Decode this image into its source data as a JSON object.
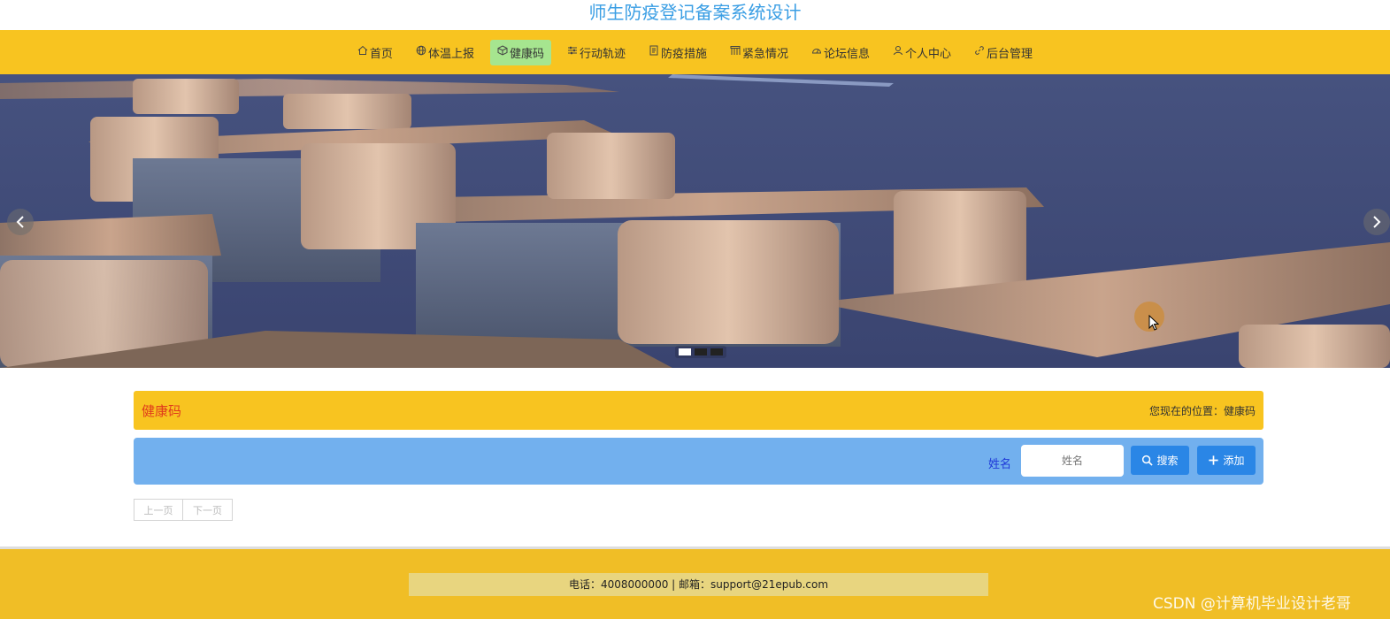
{
  "site": {
    "title": "师生防疫登记备案系统设计"
  },
  "nav": {
    "items": [
      {
        "label": "首页",
        "icon": "home-icon"
      },
      {
        "label": "体温上报",
        "icon": "globe-icon"
      },
      {
        "label": "健康码",
        "icon": "cube-icon",
        "active": true
      },
      {
        "label": "行动轨迹",
        "icon": "sliders-icon"
      },
      {
        "label": "防疫措施",
        "icon": "document-icon"
      },
      {
        "label": "紧急情况",
        "icon": "grid-icon"
      },
      {
        "label": "论坛信息",
        "icon": "dashboard-icon"
      },
      {
        "label": "个人中心",
        "icon": "user-icon"
      },
      {
        "label": "后台管理",
        "icon": "link-icon"
      }
    ]
  },
  "banner": {
    "slides": 3,
    "active_slide": 1
  },
  "crumb": {
    "title": "健康码",
    "location": "您现在的位置：健康码"
  },
  "search": {
    "label": "姓名",
    "placeholder": "姓名",
    "search_button": "搜索",
    "add_button": "添加"
  },
  "pager": {
    "prev": "上一页",
    "next": "下一页"
  },
  "footer": {
    "contact": "电话：4008000000 | 邮箱：support@21epub.com"
  },
  "watermark": "CSDN @计算机毕业设计老哥",
  "colors": {
    "title": "#3a9ee4",
    "nav_bg": "#f8c420",
    "nav_active": "#a6e58f",
    "crumb_title": "#e03c1c",
    "search_bar": "#72b0ee",
    "button": "#2a86e6",
    "footer_bg": "#f0be26"
  }
}
